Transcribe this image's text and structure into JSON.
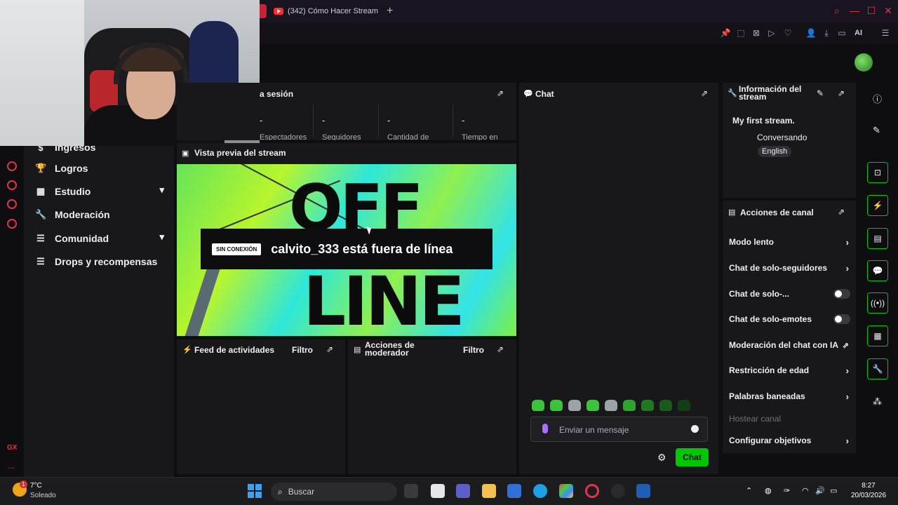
{
  "browser": {
    "tab_title": "(342) Cómo Hacer Stream",
    "new_tab": "+",
    "ai_label": "AI"
  },
  "session": {
    "title": "a sesión",
    "stats": [
      {
        "value": "-",
        "label": "Espectadores"
      },
      {
        "value": "-",
        "label": "Seguidores"
      },
      {
        "value": "-",
        "label": "Cantidad de"
      },
      {
        "value": "-",
        "label": "Tiempo en"
      }
    ]
  },
  "sidebar": {
    "items": [
      {
        "label": "Ingresos",
        "icon": "dollar-icon",
        "glyph": "$"
      },
      {
        "label": "Logros",
        "icon": "trophy-icon",
        "glyph": "🏆"
      },
      {
        "label": "Estudio",
        "icon": "studio-icon",
        "glyph": "▦"
      },
      {
        "label": "Moderación",
        "icon": "wrench-icon",
        "glyph": "🔧"
      },
      {
        "label": "Comunidad",
        "icon": "community-icon",
        "glyph": "☰"
      },
      {
        "label": "Drops y recompensas",
        "icon": "gift-icon",
        "glyph": "☰"
      }
    ]
  },
  "preview": {
    "title": "Vista previa del stream",
    "offline_badge": "SIN CONEXIÓN",
    "offline_message": "calvito_333 está fuera de línea",
    "art_word_1": "OFF",
    "art_word_2": "LINE"
  },
  "feed": {
    "title": "Feed de actividades",
    "filter": "Filtro"
  },
  "mod_actions": {
    "title": "Acciones de moderador",
    "filter": "Filtro"
  },
  "chat": {
    "title": "Chat",
    "placeholder": "Enviar un mensaje",
    "send_label": "Chat"
  },
  "stream_info": {
    "title": "Información del stream",
    "stream_title": "My first stream.",
    "category": "Conversando",
    "language": "English"
  },
  "channel_actions": {
    "title": "Acciones de canal",
    "items": [
      {
        "label": "Modo lento",
        "control": "chevron"
      },
      {
        "label": "Chat de solo-seguidores",
        "control": "chevron"
      },
      {
        "label": "Chat de solo-...",
        "control": "toggle",
        "on": false
      },
      {
        "label": "Chat de solo-emotes",
        "control": "toggle",
        "on": false
      },
      {
        "label": "Moderación del chat con IA",
        "control": "external"
      },
      {
        "label": "Restricción de edad",
        "control": "chevron"
      },
      {
        "label": "Palabras baneadas",
        "control": "chevron"
      },
      {
        "label": "Hostear canal",
        "control": "none",
        "disabled": true
      },
      {
        "label": "Configurar objetivos",
        "control": "chevron"
      }
    ]
  },
  "taskbar": {
    "weather_temp": "7°C",
    "weather_desc": "Soleado",
    "weather_badge": "1",
    "search_placeholder": "Buscar",
    "time": "8:27",
    "date": "20/03/2026"
  },
  "left_rail": {
    "gx_label": "GX",
    "more": "..."
  },
  "colors": {
    "accent_green": "#00c800",
    "opera_red": "#e0344a",
    "panel_bg": "#18181b",
    "page_bg": "#0e0e10"
  }
}
